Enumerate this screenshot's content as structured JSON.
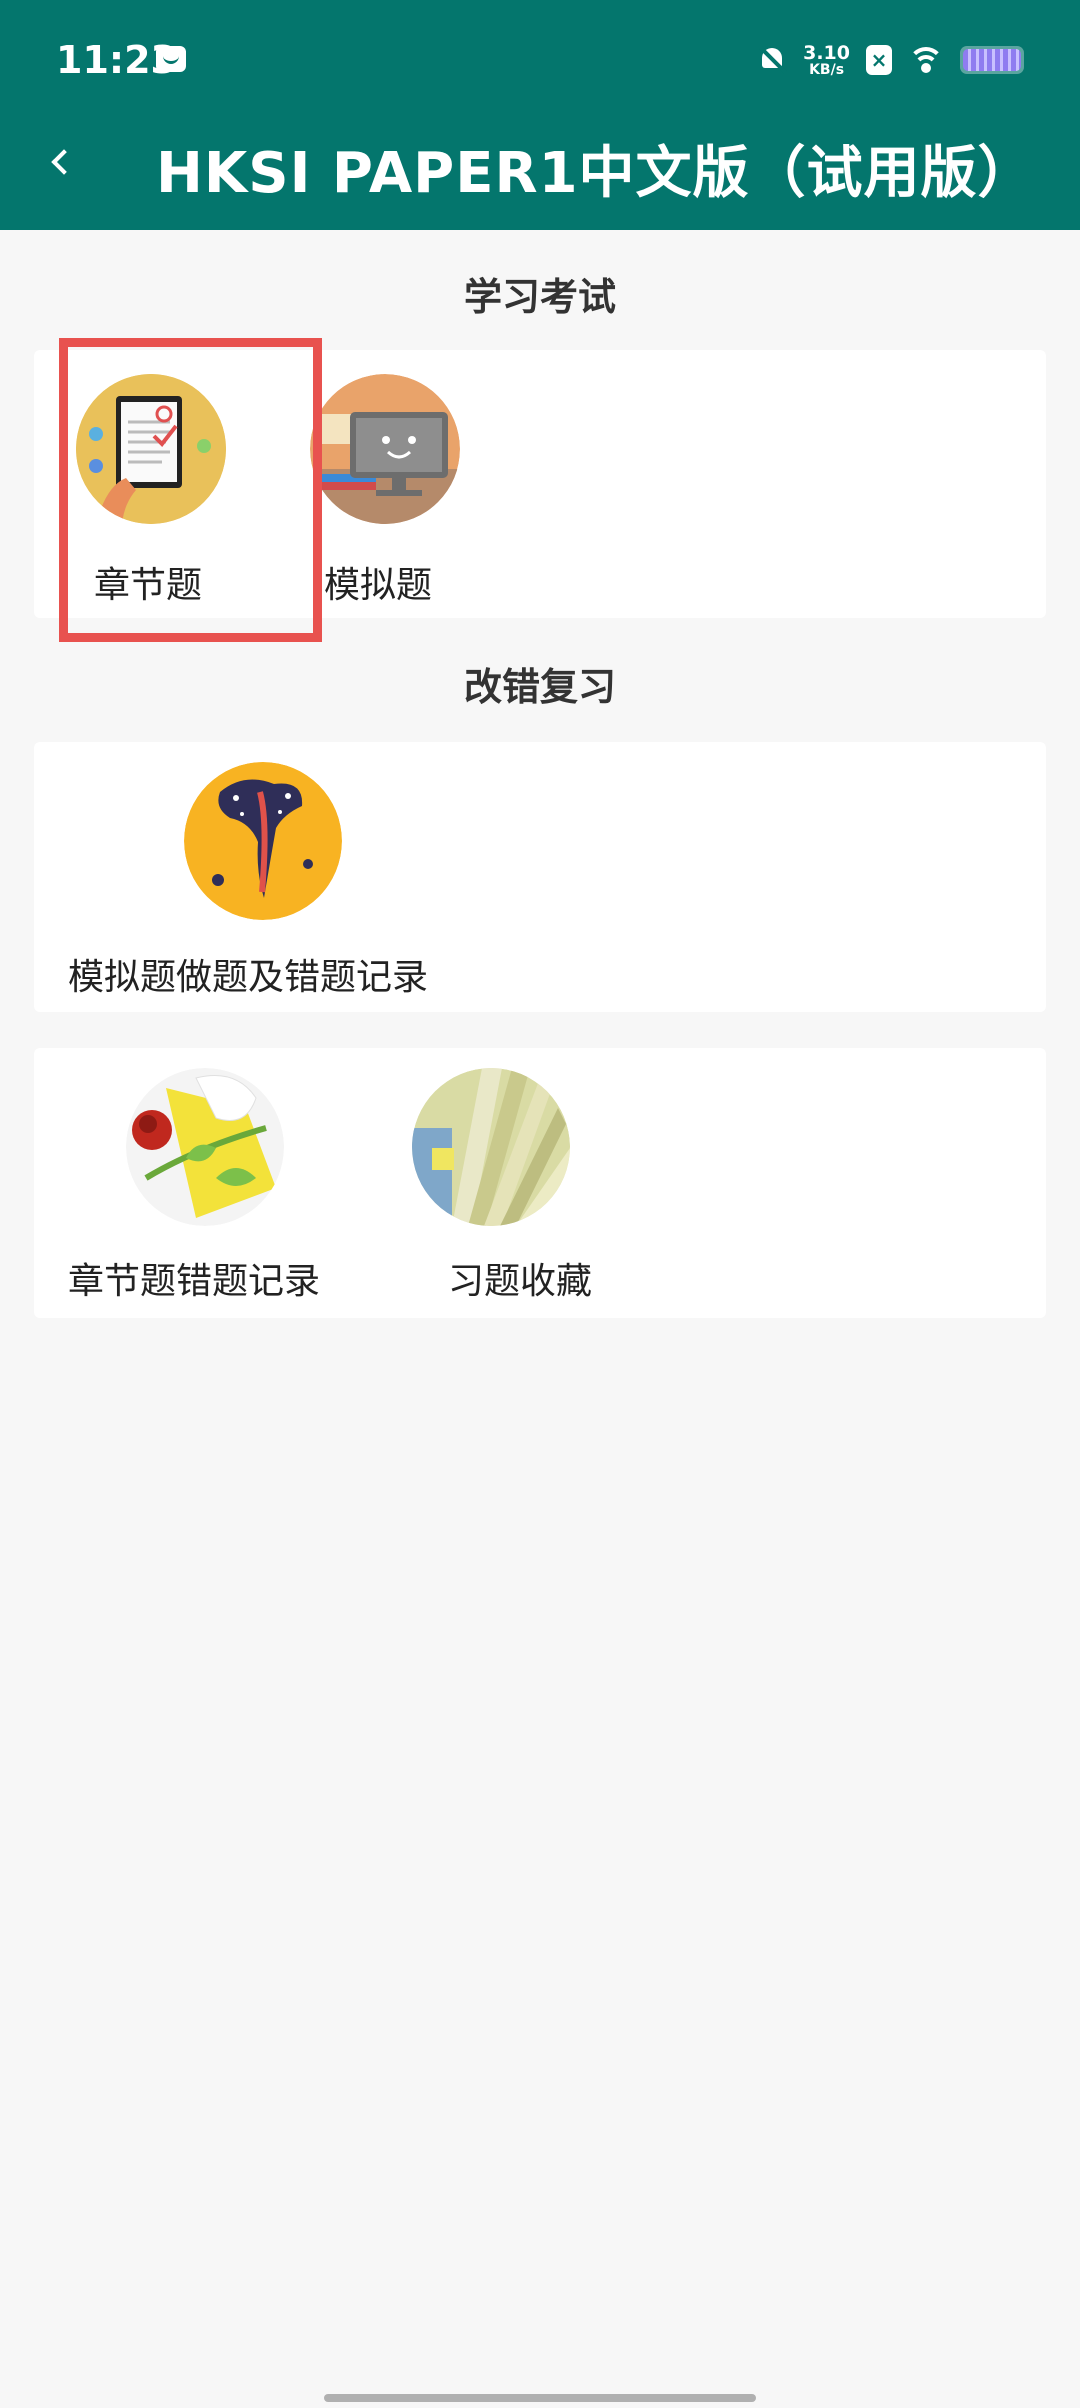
{
  "status_bar": {
    "time": "11:23",
    "net_speed_value": "3.10",
    "net_speed_unit": "KB/s"
  },
  "app_bar": {
    "title": "HKSI PAPER1中文版（试用版）",
    "back_icon": "chevron-left-icon"
  },
  "sections": {
    "study": {
      "title": "学习考试",
      "items": [
        {
          "label": "章节题",
          "icon": "document-tablet-icon"
        },
        {
          "label": "模拟题",
          "icon": "monitor-smile-icon"
        }
      ]
    },
    "review": {
      "title": "改错复习",
      "items": [
        {
          "label": "模拟题做题及错题记录",
          "icon": "starry-figure-icon"
        }
      ]
    },
    "more": {
      "items": [
        {
          "label": "章节题错题记录",
          "icon": "rose-flower-icon"
        },
        {
          "label": "习题收藏",
          "icon": "book-pages-icon"
        }
      ]
    }
  },
  "colors": {
    "primary": "#04766d",
    "highlight": "#e8524f",
    "background": "#f7f7f7"
  }
}
